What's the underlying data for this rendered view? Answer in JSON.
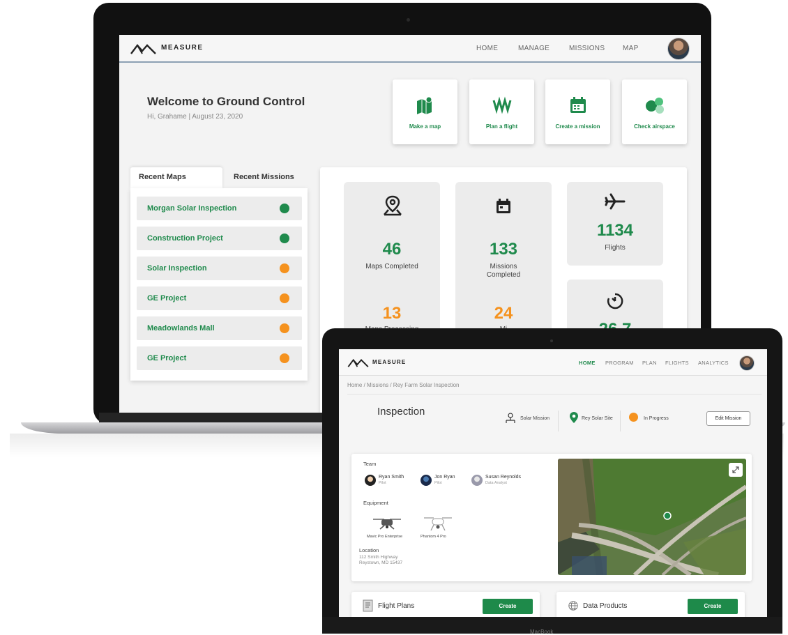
{
  "laptop": {
    "app_name": "MEASURE",
    "nav": [
      "HOME",
      "MANAGE",
      "MISSIONS",
      "MAP"
    ],
    "welcome_title": "Welcome to Ground Control",
    "welcome_sub": "Hi, Grahame | August 23, 2020",
    "quick_actions": [
      {
        "label": "Make a map",
        "icon": "map-icon"
      },
      {
        "label": "Plan a flight",
        "icon": "flight-path-icon"
      },
      {
        "label": "Create a mission",
        "icon": "calendar-icon"
      },
      {
        "label": "Check airspace",
        "icon": "airspace-circles-icon"
      }
    ],
    "tabs": [
      "Recent Maps",
      "Recent Missions"
    ],
    "recent_maps": [
      {
        "name": "Morgan Solar Inspection",
        "status_color": "#1f8a4c"
      },
      {
        "name": "Construction Project",
        "status_color": "#1f8a4c"
      },
      {
        "name": "Solar Inspection",
        "status_color": "#f5921e"
      },
      {
        "name": "GE Project",
        "status_color": "#f5921e"
      },
      {
        "name": "Meadowlands Mall",
        "status_color": "#f5921e"
      },
      {
        "name": "GE Project",
        "status_color": "#f5921e"
      }
    ],
    "stats": {
      "maps_completed": {
        "value": "46",
        "label": "Maps Completed"
      },
      "maps_processing": {
        "value": "13",
        "label": "Maps Processing"
      },
      "missions_completed": {
        "value": "133",
        "label": "Missions Completed"
      },
      "missions_other": {
        "value": "24",
        "label": "Mi"
      },
      "flights": {
        "value": "1134",
        "label": "Flights"
      },
      "hours": {
        "value": "26.7"
      }
    },
    "colors": {
      "green": "#1f8a4c",
      "orange": "#f5921e"
    }
  },
  "tablet": {
    "app_name": "MEASURE",
    "nav": [
      {
        "label": "HOME",
        "active": true
      },
      {
        "label": "PROGRAM",
        "active": false
      },
      {
        "label": "PLAN",
        "active": false
      },
      {
        "label": "FLIGHTS",
        "active": false
      },
      {
        "label": "ANALYTICS",
        "active": false
      }
    ],
    "breadcrumb": "Home  /  Missions  /  Rey Farm Solar Inspection",
    "title": "Inspection",
    "meta": {
      "mission_type": "Solar Mission",
      "site": "Rey Solar Site",
      "status": "In Progress"
    },
    "edit_button": "Edit Mission",
    "team_heading": "Team",
    "team": [
      {
        "name": "Ryan Smith",
        "role": "Pilot"
      },
      {
        "name": "Jon Ryan",
        "role": "Pilot"
      },
      {
        "name": "Susan Reynolds",
        "role": "Data Analyst"
      }
    ],
    "equipment_heading": "Equipment",
    "equipment": [
      "Mavic Pro Enterprise",
      "Phantom 4 Pro"
    ],
    "location_heading": "Location",
    "location_lines": [
      "112 Smith Highway",
      "Reystown, MD 15437"
    ],
    "flight_plans": {
      "title": "Flight Plans",
      "button": "Create"
    },
    "data_products": {
      "title": "Data Products",
      "button": "Create"
    },
    "bottom_label": "MacBook"
  }
}
